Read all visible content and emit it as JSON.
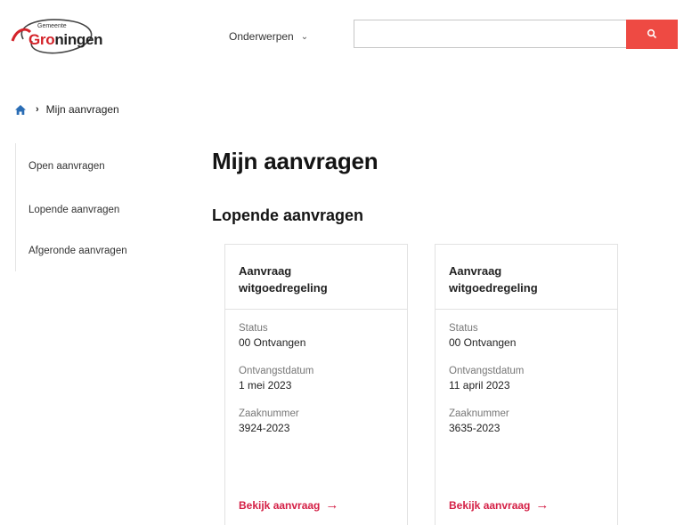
{
  "header": {
    "logo": {
      "small_text": "Gemeente",
      "big_text_red": "Gro",
      "big_text_dark": "ningen"
    },
    "nav_topics_label": "Onderwerpen",
    "search": {
      "value": "",
      "placeholder": ""
    }
  },
  "breadcrumb": {
    "current": "Mijn aanvragen"
  },
  "sidebar": {
    "items": [
      {
        "label": "Open aanvragen"
      },
      {
        "label": "Lopende aanvragen"
      },
      {
        "label": "Afgeronde aanvragen"
      }
    ]
  },
  "main": {
    "title": "Mijn aanvragen",
    "section_title": "Lopende aanvragen",
    "cards": [
      {
        "title": "Aanvraag witgoedregeling",
        "status_label": "Status",
        "status_value": "00 Ontvangen",
        "date_label": "Ontvangstdatum",
        "date_value": "1 mei 2023",
        "case_label": "Zaaknummer",
        "case_value": "3924-2023",
        "link_label": "Bekijk aanvraag"
      },
      {
        "title": "Aanvraag witgoedregeling",
        "status_label": "Status",
        "status_value": "00 Ontvangen",
        "date_label": "Ontvangstdatum",
        "date_value": "11 april 2023",
        "case_label": "Zaaknummer",
        "case_value": "3635-2023",
        "link_label": "Bekijk aanvraag"
      }
    ]
  },
  "colors": {
    "accent_red": "#ee4a43",
    "link_red": "#d41f45",
    "home_blue": "#2a6db5"
  },
  "icons": {
    "home": "home-icon",
    "search": "search-icon",
    "chevron": "chevron-down-icon",
    "arrow": "arrow-right-icon"
  }
}
